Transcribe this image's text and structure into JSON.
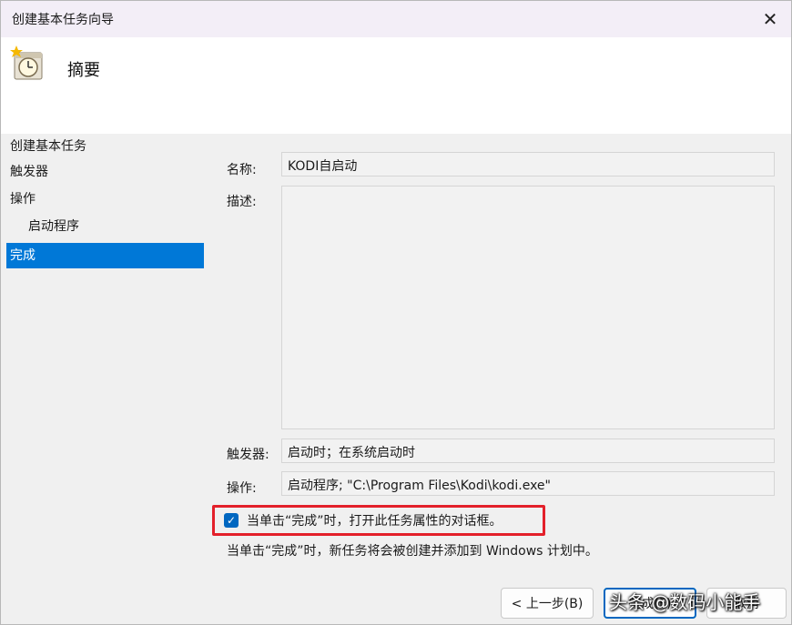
{
  "window": {
    "title": "创建基本任务向导",
    "close_glyph": "✕"
  },
  "header": {
    "title": "摘要",
    "icon": "scheduled-task-clock-icon"
  },
  "nav": {
    "items": [
      {
        "label": "创建基本任务",
        "active": false
      },
      {
        "label": "触发器",
        "active": false
      },
      {
        "label": "操作",
        "active": false
      },
      {
        "label": "启动程序",
        "active": false
      },
      {
        "label": "完成",
        "active": true
      }
    ]
  },
  "summary": {
    "name_label": "名称:",
    "name_value": "KODI自启动",
    "description_label": "描述:",
    "description_value": "",
    "trigger_label": "触发器:",
    "trigger_value": "启动时；在系统启动时",
    "action_label": "操作:",
    "action_value": "启动程序; \"C:\\Program Files\\Kodi\\kodi.exe\""
  },
  "open_properties": {
    "label": "当单击“完成”时，打开此任务属性的对话框。",
    "checked": true
  },
  "info_text": "当单击“完成”时，新任务将会被创建并添加到 Windows 计划中。",
  "buttons": {
    "back": "< 上一步(B)",
    "finish": "完成(F)",
    "cancel": "取消"
  },
  "watermark": "头条 @数码小能手",
  "colors": {
    "accent": "#0078d7",
    "highlight_border": "#e3202a",
    "checkbox": "#0067c0"
  }
}
